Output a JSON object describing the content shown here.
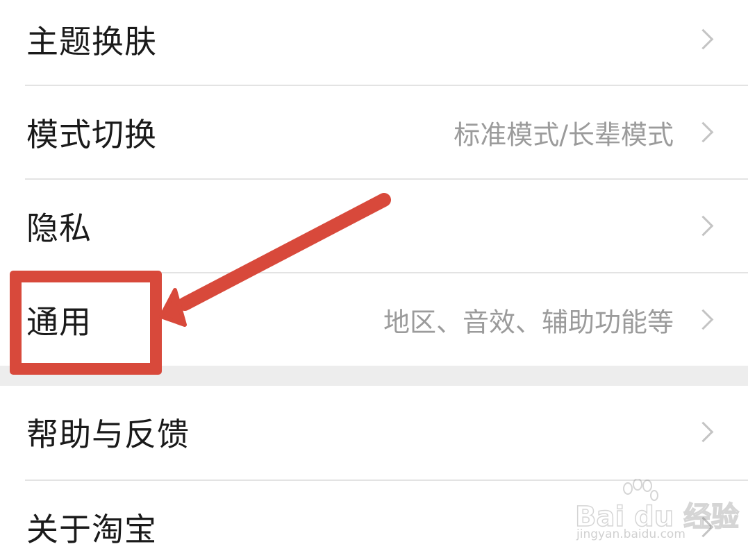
{
  "settings_list": {
    "items": [
      {
        "label": "主题换肤",
        "value": ""
      },
      {
        "label": "模式切换",
        "value": "标准模式/长辈模式"
      },
      {
        "label": "隐私",
        "value": ""
      },
      {
        "label": "通用",
        "value": "地区、音效、辅助功能等"
      },
      {
        "label": "帮助与反馈",
        "value": ""
      },
      {
        "label": "关于淘宝",
        "value": ""
      }
    ]
  },
  "annotation": {
    "color": "#d8493b",
    "target": "通用"
  },
  "watermark": {
    "brand": "Bai du 经验",
    "url": "jingyan.baidu.com"
  },
  "icons": {
    "chevron": "chevron-right-icon",
    "paw": "baidu-paw-icon"
  }
}
